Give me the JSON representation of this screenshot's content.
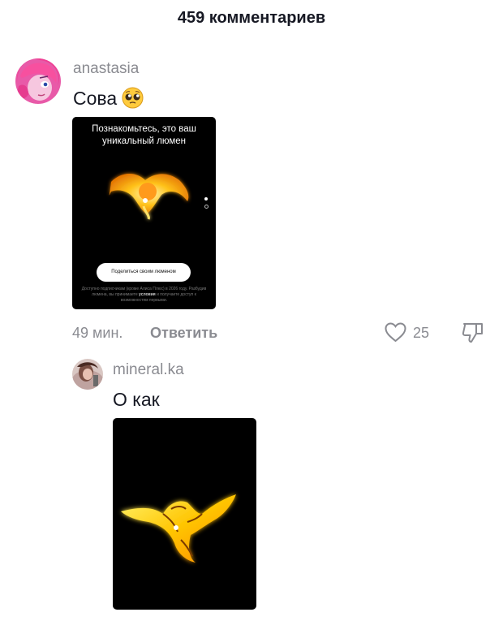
{
  "header": {
    "title": "459 комментариев"
  },
  "comments": [
    {
      "username": "anastasia",
      "text": "Сова",
      "emoji": "pleading-face",
      "time": "49 мин.",
      "reply_label": "Ответить",
      "likes": "25",
      "promo": {
        "title": "Познакомьтесь, это ваш уникальный люмен",
        "share_button": "Поделиться своим люменом",
        "fine_print_before": "Доступно подписчикам (кроме Алиса Плюс) в 2026 году. Разбудив люмена, вы принимаете",
        "fine_print_link": "условия",
        "fine_print_after": "и получаете доступ к возможностям первыми."
      }
    },
    {
      "username": "mineral.ka",
      "text": "О как"
    }
  ],
  "icons": {
    "like": "heart-outline-icon",
    "dislike": "thumbs-down-outline-icon"
  },
  "colors": {
    "text": "#161823",
    "secondary": "#8a8b91",
    "glow": "#ffd21a"
  }
}
